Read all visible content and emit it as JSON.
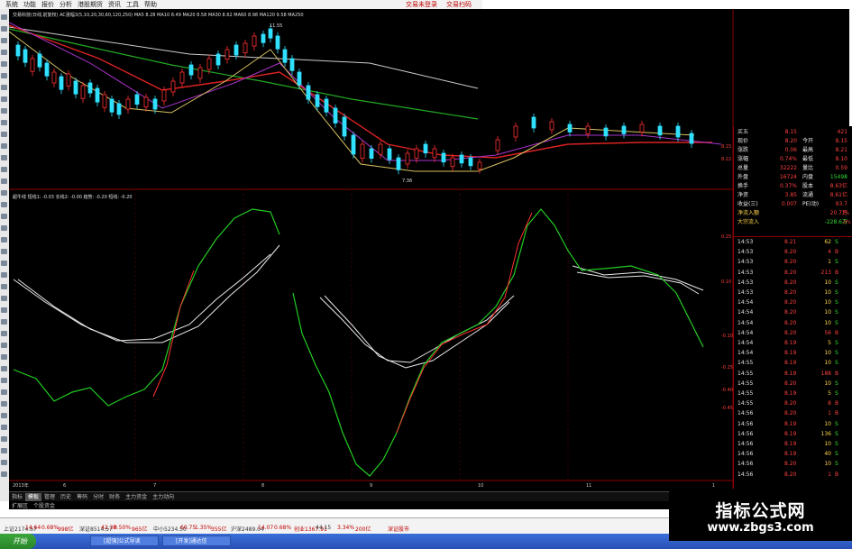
{
  "menu": {
    "items": [
      "系统",
      "功能",
      "报价",
      "分析",
      "港股期货",
      "资讯",
      "工具",
      "帮助"
    ],
    "right_items": [
      "交易未登录",
      "交易扫码"
    ]
  },
  "main_chart": {
    "legend": "交易科技(日线,前复权) AC涨幅3(5,10,20,30,60,120,250) MA5 8.28 MA10 8.49 MA20 8.58 MA30 8.62 MA60 8.98 MA120 9.58 MA250",
    "high_label": "11.55",
    "low_label": "7.36",
    "axis_labels": [
      "8.15",
      "8.22"
    ]
  },
  "indicator": {
    "legend": "超牛线 短线1: -0.03 长线2: -0.00 趋势: -0.20 短线: -0.20",
    "axis_labels": [
      "0.25",
      "0.10",
      "-0.10",
      "-0.25",
      "-0.40",
      "-0.45"
    ]
  },
  "date_axis": [
    "2013年",
    "6",
    "7",
    "8",
    "9",
    "10",
    "11",
    "1"
  ],
  "bottom_tabs": [
    "指标",
    "模板",
    "管理",
    "历史",
    "筹码",
    "分时",
    "财务",
    "主力资金",
    "主力动向"
  ],
  "bottom_tabs2": [
    "扩展区",
    "个股资金"
  ],
  "quote_panel": {
    "rows": [
      {
        "k1": "买五",
        "v1": "8.15",
        "k2": "",
        "v2": "421"
      },
      {
        "k1": "现价",
        "v1": "8.20",
        "k2": "今开",
        "v2": "8.15"
      },
      {
        "k1": "涨跌",
        "v1": "0.06",
        "k2": "最高",
        "v2": "8.21"
      },
      {
        "k1": "涨幅",
        "v1": "0.74%",
        "k2": "最低",
        "v2": "8.10"
      },
      {
        "k1": "总量",
        "v1": "32222",
        "k2": "量比",
        "v2": "0.59"
      },
      {
        "k1": "外盘",
        "v1": "16724",
        "k2": "内盘",
        "v2": "15498"
      },
      {
        "k1": "换手",
        "v1": "0.37%",
        "k2": "股本",
        "v2": "8.63亿"
      },
      {
        "k1": "净资",
        "v1": "3.85",
        "k2": "流通",
        "v2": "8.61亿"
      },
      {
        "k1": "收益(三)",
        "v1": "0.007",
        "k2": "PE(动)",
        "v2": "93.7"
      },
      {
        "k1": "净流入额",
        "v1": "",
        "k2": "",
        "v2": "20.7万"
      },
      {
        "k1": "大宗流入",
        "v1": "",
        "k2": "",
        "v2": "-228.6万"
      }
    ],
    "row_tail": [
      "1%",
      "-0%"
    ],
    "ticks": [
      {
        "t": "14:53",
        "p": "8.21",
        "v": "62",
        "d": "S"
      },
      {
        "t": "14:53",
        "p": "8.20",
        "v": "4",
        "d": "B"
      },
      {
        "t": "14:53",
        "p": "8.20",
        "v": "1",
        "d": "S"
      },
      {
        "t": "14:53",
        "p": "8.20",
        "v": "213",
        "d": "B"
      },
      {
        "t": "14:53",
        "p": "8.20",
        "v": "10",
        "d": "S"
      },
      {
        "t": "14:53",
        "p": "8.20",
        "v": "10",
        "d": "S"
      },
      {
        "t": "14:54",
        "p": "8.20",
        "v": "10",
        "d": "S"
      },
      {
        "t": "14:54",
        "p": "8.20",
        "v": "10",
        "d": "S"
      },
      {
        "t": "14:54",
        "p": "8.20",
        "v": "10",
        "d": "S"
      },
      {
        "t": "14:54",
        "p": "8.20",
        "v": "56",
        "d": "B"
      },
      {
        "t": "14:54",
        "p": "8.19",
        "v": "5",
        "d": "S"
      },
      {
        "t": "14:54",
        "p": "8.19",
        "v": "10",
        "d": "S"
      },
      {
        "t": "14:55",
        "p": "8.19",
        "v": "10",
        "d": "S"
      },
      {
        "t": "14:55",
        "p": "8.19",
        "v": "188",
        "d": "B"
      },
      {
        "t": "14:55",
        "p": "8.20",
        "v": "10",
        "d": "S"
      },
      {
        "t": "14:55",
        "p": "8.19",
        "v": "5",
        "d": "S"
      },
      {
        "t": "14:55",
        "p": "8.20",
        "v": "8",
        "d": "B"
      },
      {
        "t": "14:56",
        "p": "8.20",
        "v": "1",
        "d": "B"
      },
      {
        "t": "14:56",
        "p": "8.19",
        "v": "10",
        "d": "S"
      },
      {
        "t": "14:56",
        "p": "8.19",
        "v": "136",
        "d": "S"
      },
      {
        "t": "14:56",
        "p": "8.19",
        "v": "10",
        "d": "S"
      },
      {
        "t": "14:56",
        "p": "8.19",
        "v": "40",
        "d": "S"
      },
      {
        "t": "14:56",
        "p": "8.20",
        "v": "10",
        "d": "S"
      },
      {
        "t": "14:56",
        "p": "8.20",
        "v": "1",
        "d": "B"
      }
    ]
  },
  "status_bar": {
    "segments": [
      "上证2174.67",
      "14.64",
      "0.68%",
      "998亿",
      "深证8514.57",
      "42.38",
      "0.50%",
      "965亿",
      "中小5234.50",
      "60.75",
      "1.35%",
      "355亿",
      "沪深2489.04",
      "14.07",
      "0.68%",
      "创业1367.91",
      "44.15",
      "3.34%",
      "200亿",
      "深证股市"
    ]
  },
  "taskbar": {
    "start_label": "开始",
    "tasks": [
      "[超强]公式导读",
      "[开发]通达信"
    ]
  },
  "watermark": {
    "title": "指标公式网",
    "url": "www.zbgs3.com"
  },
  "colors": {
    "up": "#ff3030",
    "down": "#33dd33",
    "candle_down": "#30e0ff"
  }
}
